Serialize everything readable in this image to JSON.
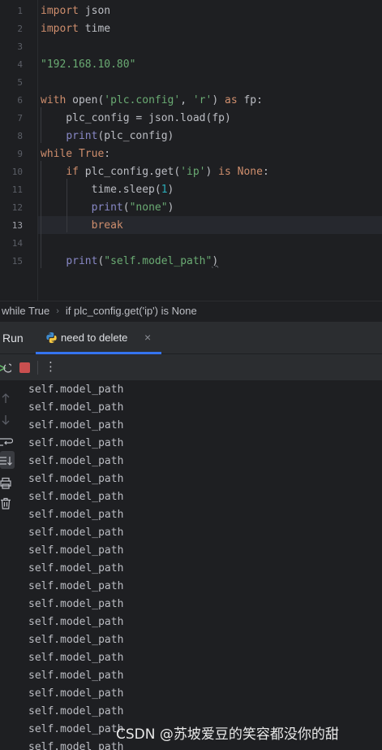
{
  "editor": {
    "current_line": 13,
    "lines": [
      {
        "n": "1",
        "tokens": [
          {
            "t": "import",
            "c": "kw"
          },
          {
            "t": " json",
            "c": ""
          }
        ]
      },
      {
        "n": "2",
        "tokens": [
          {
            "t": "import",
            "c": "kw"
          },
          {
            "t": " time",
            "c": ""
          }
        ]
      },
      {
        "n": "3",
        "tokens": []
      },
      {
        "n": "4",
        "tokens": [
          {
            "t": "\"192.168.10.80\"",
            "c": "st"
          }
        ]
      },
      {
        "n": "5",
        "tokens": []
      },
      {
        "n": "6",
        "tokens": [
          {
            "t": "with",
            "c": "kw"
          },
          {
            "t": " open(",
            "c": ""
          },
          {
            "t": "'plc.config'",
            "c": "st"
          },
          {
            "t": ", ",
            "c": ""
          },
          {
            "t": "'r'",
            "c": "st"
          },
          {
            "t": ") ",
            "c": ""
          },
          {
            "t": "as",
            "c": "kw"
          },
          {
            "t": " fp:",
            "c": ""
          }
        ]
      },
      {
        "n": "7",
        "tokens": [
          {
            "t": "    plc_config = json.load(fp)",
            "c": ""
          }
        ]
      },
      {
        "n": "8",
        "tokens": [
          {
            "t": "    ",
            "c": ""
          },
          {
            "t": "print",
            "c": "bi"
          },
          {
            "t": "(plc_config)",
            "c": ""
          }
        ]
      },
      {
        "n": "9",
        "tokens": [
          {
            "t": "while",
            "c": "kw"
          },
          {
            "t": " ",
            "c": ""
          },
          {
            "t": "True",
            "c": "kw"
          },
          {
            "t": ":",
            "c": ""
          }
        ]
      },
      {
        "n": "10",
        "tokens": [
          {
            "t": "    ",
            "c": ""
          },
          {
            "t": "if",
            "c": "kw"
          },
          {
            "t": " plc_config.get(",
            "c": ""
          },
          {
            "t": "'ip'",
            "c": "st"
          },
          {
            "t": ") ",
            "c": ""
          },
          {
            "t": "is",
            "c": "kw"
          },
          {
            "t": " ",
            "c": ""
          },
          {
            "t": "None",
            "c": "kw"
          },
          {
            "t": ":",
            "c": ""
          }
        ]
      },
      {
        "n": "11",
        "tokens": [
          {
            "t": "        time.sleep(",
            "c": ""
          },
          {
            "t": "1",
            "c": "num"
          },
          {
            "t": ")",
            "c": ""
          }
        ]
      },
      {
        "n": "12",
        "tokens": [
          {
            "t": "        ",
            "c": ""
          },
          {
            "t": "print",
            "c": "bi"
          },
          {
            "t": "(",
            "c": ""
          },
          {
            "t": "\"none\"",
            "c": "st"
          },
          {
            "t": ")",
            "c": ""
          }
        ]
      },
      {
        "n": "13",
        "tokens": [
          {
            "t": "        ",
            "c": ""
          },
          {
            "t": "break",
            "c": "kw"
          }
        ]
      },
      {
        "n": "14",
        "tokens": []
      },
      {
        "n": "15",
        "tokens": [
          {
            "t": "    ",
            "c": ""
          },
          {
            "t": "print",
            "c": "bi"
          },
          {
            "t": "(",
            "c": ""
          },
          {
            "t": "\"self.model_path\"",
            "c": "st"
          },
          {
            "t": ")",
            "c": "squig"
          }
        ]
      }
    ]
  },
  "breadcrumb": {
    "items": [
      "while True",
      "if plc_config.get('ip') is None"
    ],
    "separator": "›"
  },
  "run_panel": {
    "title": "Run",
    "tab_label": "need to delete",
    "tab_close": "×",
    "more_label": "⋮",
    "tab_icon": "python-icon",
    "toolbar_icons": [
      "rerun-icon",
      "stop-icon",
      "more-icon"
    ],
    "side_icons": [
      "arrow-up-icon",
      "arrow-down-icon",
      "soft-wrap-icon",
      "scroll-to-end-icon",
      "print-icon",
      "trash-icon"
    ],
    "output_lines": [
      "self.model_path",
      "self.model_path",
      "self.model_path",
      "self.model_path",
      "self.model_path",
      "self.model_path",
      "self.model_path",
      "self.model_path",
      "self.model_path",
      "self.model_path",
      "self.model_path",
      "self.model_path",
      "self.model_path",
      "self.model_path",
      "self.model_path",
      "self.model_path",
      "self.model_path",
      "self.model_path",
      "self.model_path",
      "self.model_path",
      "self.model_path"
    ]
  },
  "colors": {
    "keyword": "#cf8e6d",
    "string": "#6aab73",
    "number": "#2aacb8",
    "builtin": "#8888c6",
    "tab_underline": "#3574f0",
    "stop": "#c94f4f"
  },
  "watermark": "CSDN @苏坡爱豆的笑容都没你的甜"
}
